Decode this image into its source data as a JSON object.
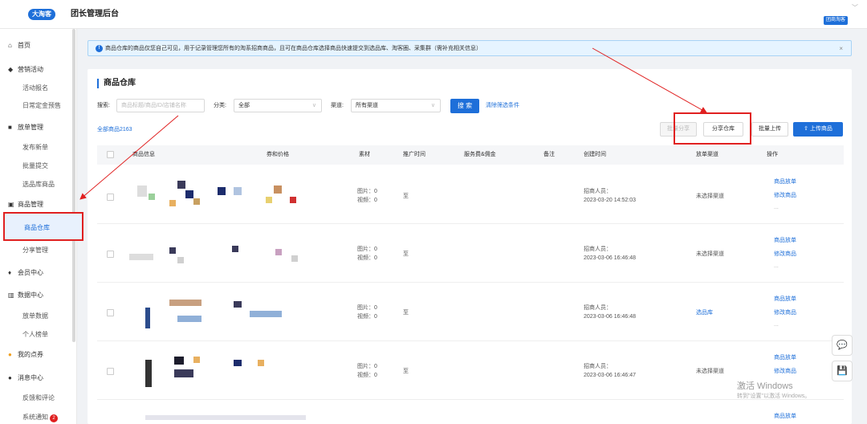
{
  "header": {
    "brand_badge": "大淘客",
    "title": "团长管理后台",
    "user_badge": "团商淘客",
    "chevron": "﹀"
  },
  "sidebar": {
    "home": "首页",
    "marketing": {
      "label": "营销活动",
      "items": [
        "活动报名",
        "日常定金预售"
      ]
    },
    "orders": {
      "label": "放单管理",
      "items": [
        "发布新单",
        "批量提交",
        "选品库商品"
      ]
    },
    "products": {
      "label": "商品管理",
      "items": [
        "商品仓库",
        "分享管理"
      ]
    },
    "member": "会员中心",
    "data": {
      "label": "数据中心",
      "items": [
        "放单数据",
        "个人榜单"
      ]
    },
    "points": "我的点券",
    "messages": {
      "label": "消息中心",
      "items": [
        "反馈和评论",
        "系统通知"
      ],
      "notify_count": "2"
    }
  },
  "notice": {
    "icon": "!",
    "text": "商品仓库的商品仅您自己可见，用于记录管理您所有的淘系招商商品，且可在商品仓库选择商品快速提交到选品库、淘客圈、采集群（需补充相关信息）",
    "close": "×"
  },
  "panel": {
    "title": "商品仓库",
    "search_label": "搜索:",
    "search_placeholder": "商品标题/商品ID/店铺名称",
    "category_label": "分类:",
    "category_value": "全部",
    "channel_label": "渠道:",
    "channel_value": "所有渠道",
    "select_chevron": "∨",
    "search_button": "搜 索",
    "clear_link": "清除筛选条件",
    "count_label": "全部商品2163",
    "btn_batch_share": "批量分享",
    "btn_share_warehouse": "分享仓库",
    "btn_batch_upload": "批量上传",
    "btn_upload": "⇧ 上传商品"
  },
  "table": {
    "columns": [
      "商品信息",
      "券和价格",
      "素材",
      "推广时间",
      "服务费&佣金",
      "备注",
      "创建时间",
      "放单渠道",
      "操作"
    ],
    "rows": [
      {
        "material_images": "图片：0",
        "material_videos": "视频：0",
        "promo_time": "至",
        "creator_label": "招商人员：",
        "created": "2023-03-20 14:52:03",
        "channel": "未选择渠道",
        "channel_is_link": false,
        "action1": "商品放单",
        "action2": "修改商品",
        "more": "..."
      },
      {
        "material_images": "图片：0",
        "material_videos": "视频：0",
        "promo_time": "至",
        "creator_label": "招商人员：",
        "created": "2023-03-06 16:46:48",
        "channel": "未选择渠道",
        "channel_is_link": false,
        "action1": "商品放单",
        "action2": "修改商品",
        "more": "..."
      },
      {
        "material_images": "图片：0",
        "material_videos": "视频：0",
        "promo_time": "至",
        "creator_label": "招商人员：",
        "created": "2023-03-06 16:46:48",
        "channel": "选品库",
        "channel_is_link": true,
        "action1": "商品放单",
        "action2": "修改商品",
        "more": "..."
      },
      {
        "material_images": "图片：0",
        "material_videos": "视频：0",
        "promo_time": "至",
        "creator_label": "招商人员：",
        "created": "2023-03-06 16:46:47",
        "channel": "未选择渠道",
        "channel_is_link": false,
        "action1": "商品放单",
        "action2": "修改商品",
        "more": "..."
      },
      {
        "action1": "商品放单"
      }
    ]
  },
  "float": {
    "chat_icon": "💬",
    "save_icon": "💾"
  },
  "watermark": {
    "line1": "激活 Windows",
    "line2": "转到\"设置\"以激活 Windows。"
  },
  "colors": {
    "accent": "#1e6fd9",
    "highlight": "#e02020"
  }
}
